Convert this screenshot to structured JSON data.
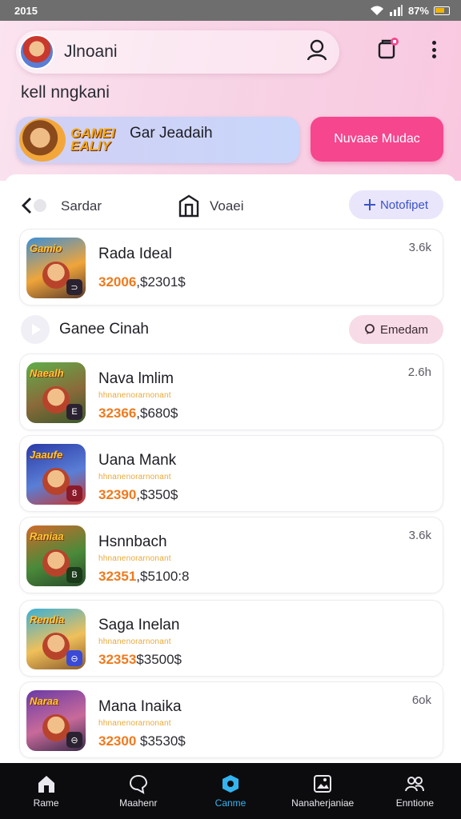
{
  "status": {
    "time": "2015",
    "battery": "87%"
  },
  "profile": {
    "name": "Jlnoani",
    "greeting": "kell nngkani"
  },
  "banner": {
    "logo_line1": "GAMEI",
    "logo_line2": "EALIY",
    "title": "Gar Jeadaih",
    "cta": "Nuvaae Mudac"
  },
  "filters": {
    "back_label": "Sardar",
    "store_label": "Voaei",
    "notify_label": "Notofipet"
  },
  "featured": {
    "title": "Rada Ideal",
    "price_hi": "32006",
    "price_rest": ",$2301$",
    "count": "3.6k",
    "thumb_text": "Gamio",
    "badge": "⊃"
  },
  "section": {
    "title": "Ganee Cinah",
    "chip_label": "Emedam"
  },
  "games": [
    {
      "title": "Nava lmlim",
      "sub": "hhnanenorarnonant",
      "price_hi": "32366",
      "price_rest": ",$680$",
      "count": "2.6h",
      "thumb_text": "Naealh",
      "badge": "E"
    },
    {
      "title": "Uana Mank",
      "sub": "hhnanenorarnonant",
      "price_hi": "32390",
      "price_rest": ",$350$",
      "count": "",
      "thumb_text": "Jaaufe",
      "badge": "8"
    },
    {
      "title": "Hsnnbach",
      "sub": "hhnanenorarnonant",
      "price_hi": "32351",
      "price_rest": ",$5100:8",
      "count": "3.6k",
      "thumb_text": "Raniaa",
      "badge": "B"
    },
    {
      "title": "Saga Inelan",
      "sub": "hhnanenorarnonant",
      "price_hi": "32353",
      "price_rest": "$3500$",
      "count": "",
      "thumb_text": "Rendia",
      "badge": "⊖"
    },
    {
      "title": "Mana Inaika",
      "sub": "hhnanenorarnonant",
      "price_hi": "32300",
      "price_rest": " $3530$",
      "count": "6ok",
      "thumb_text": "Naraa",
      "badge": "⊖"
    }
  ],
  "nav": [
    {
      "label": "Rame",
      "icon": "home-icon"
    },
    {
      "label": "Maahenr",
      "icon": "chat-icon"
    },
    {
      "label": "Canme",
      "icon": "game-icon"
    },
    {
      "label": "Nanaherjaniae",
      "icon": "gallery-icon"
    },
    {
      "label": "Enntione",
      "icon": "people-icon"
    }
  ],
  "colors": {
    "accent_pink": "#f5468e",
    "active_nav": "#34b3f0",
    "price_orange": "#ef7a1d"
  }
}
